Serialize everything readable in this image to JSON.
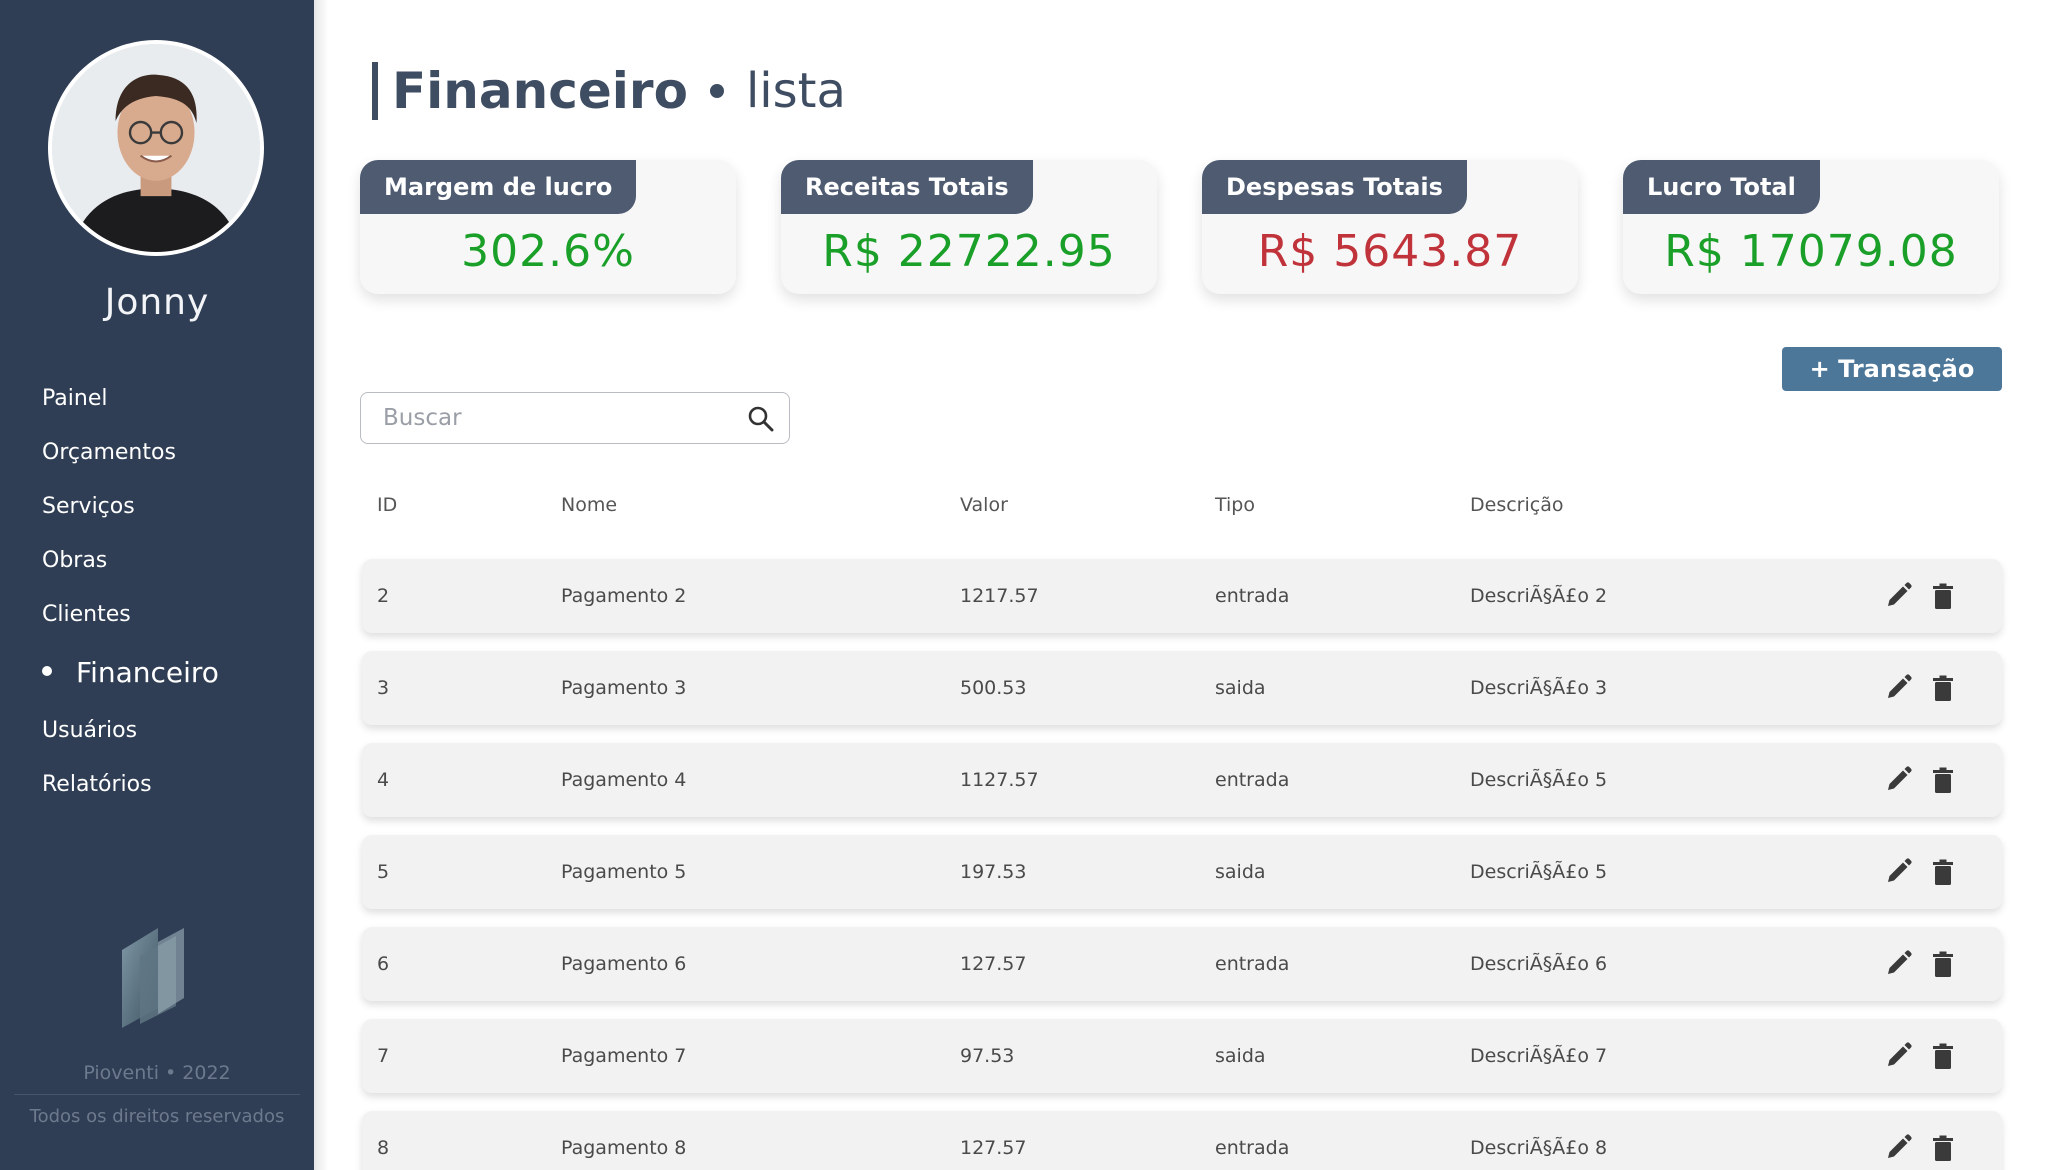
{
  "sidebar": {
    "user_name": "Jonny",
    "nav": [
      {
        "label": "Painel"
      },
      {
        "label": "Orçamentos"
      },
      {
        "label": "Serviços"
      },
      {
        "label": "Obras"
      },
      {
        "label": "Clientes"
      },
      {
        "label": "Financeiro",
        "active": true
      },
      {
        "label": "Usuários"
      },
      {
        "label": "Relatórios"
      }
    ],
    "footer_brand": "Pioventi • 2022",
    "footer_rights": "Todos os direitos reservados"
  },
  "header": {
    "title": "Financeiro",
    "subtitle": "lista"
  },
  "stats": [
    {
      "label": "Margem de lucro",
      "value": "302.6%",
      "color": "#1aa028"
    },
    {
      "label": "Receitas Totais",
      "value": "R$ 22722.95",
      "color": "#1aa028"
    },
    {
      "label": "Despesas Totais",
      "value": "R$ 5643.87",
      "color": "#c0333a"
    },
    {
      "label": "Lucro Total",
      "value": "R$ 17079.08",
      "color": "#1aa028"
    }
  ],
  "search": {
    "placeholder": "Buscar",
    "icon": "search-icon"
  },
  "add_button": {
    "label": "+ Transação"
  },
  "table": {
    "columns": [
      "ID",
      "Nome",
      "Valor",
      "Tipo",
      "Descrição"
    ],
    "rows": [
      {
        "id": "2",
        "nome": "Pagamento 2",
        "valor": "1217.57",
        "tipo": "entrada",
        "descricao": "DescriÃ§Ã£o 2"
      },
      {
        "id": "3",
        "nome": "Pagamento 3",
        "valor": "500.53",
        "tipo": "saida",
        "descricao": "DescriÃ§Ã£o 3"
      },
      {
        "id": "4",
        "nome": "Pagamento 4",
        "valor": "1127.57",
        "tipo": "entrada",
        "descricao": "DescriÃ§Ã£o 5"
      },
      {
        "id": "5",
        "nome": "Pagamento 5",
        "valor": "197.53",
        "tipo": "saida",
        "descricao": "DescriÃ§Ã£o 5"
      },
      {
        "id": "6",
        "nome": "Pagamento 6",
        "valor": "127.57",
        "tipo": "entrada",
        "descricao": "DescriÃ§Ã£o 6"
      },
      {
        "id": "7",
        "nome": "Pagamento 7",
        "valor": "97.53",
        "tipo": "saida",
        "descricao": "DescriÃ§Ã£o 7"
      },
      {
        "id": "8",
        "nome": "Pagamento 8",
        "valor": "127.57",
        "tipo": "entrada",
        "descricao": "DescriÃ§Ã£o 8"
      }
    ],
    "row_actions": [
      "pencil-icon",
      "trash-icon"
    ]
  },
  "colors": {
    "sidebar_bg": "#2f3e55",
    "accent_button": "#4d7799",
    "card_tab": "#4e5b71",
    "positive": "#1aa028",
    "negative": "#c0333a"
  }
}
